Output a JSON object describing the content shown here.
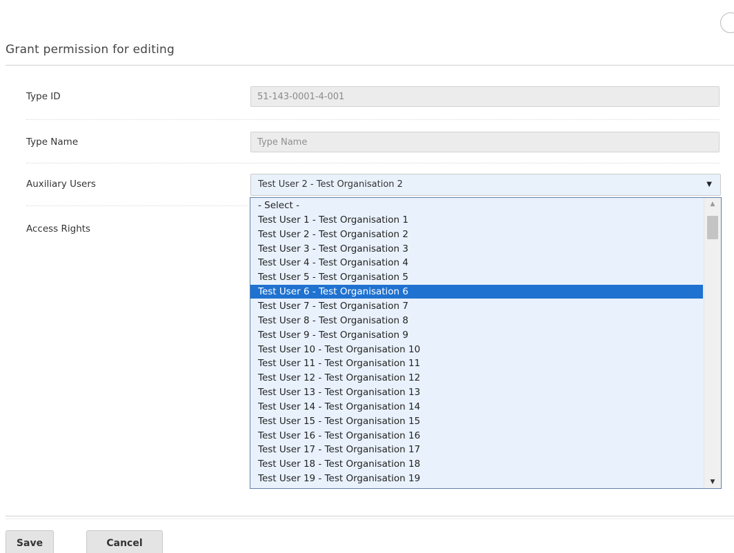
{
  "dialog": {
    "title": "Grant permission for editing"
  },
  "form": {
    "type_id_label": "Type ID",
    "type_id_value": "51-143-0001-4-001",
    "type_name_label": "Type Name",
    "type_name_placeholder": "Type Name",
    "auxiliary_users_label": "Auxiliary Users",
    "auxiliary_users_selected": "Test User 2 - Test Organisation 2",
    "access_rights_label": "Access Rights"
  },
  "dropdown": {
    "arrow_icon": "▼",
    "highlighted_index": 6,
    "options": [
      "- Select -",
      "Test User 1 - Test Organisation 1",
      "Test User 2 - Test Organisation 2",
      "Test User 3 - Test Organisation 3",
      "Test User 4 - Test Organisation 4",
      "Test User 5 - Test Organisation 5",
      "Test User 6 - Test Organisation 6",
      "Test User 7 - Test Organisation 7",
      "Test User 8 - Test Organisation 8",
      "Test User 9 - Test Organisation 9",
      "Test User 10 - Test Organisation 10",
      "Test User 11 - Test Organisation 11",
      "Test User 12 - Test Organisation 12",
      "Test User 13 - Test Organisation 13",
      "Test User 14 - Test Organisation 14",
      "Test User 15 - Test Organisation 15",
      "Test User 16 - Test Organisation 16",
      "Test User 17 - Test Organisation 17",
      "Test User 18 - Test Organisation 18",
      "Test User 19 - Test Organisation 19"
    ],
    "scroll_up_icon": "▲",
    "scroll_down_icon": "▼"
  },
  "footer": {
    "save_label": "Save",
    "cancel_label": "Cancel"
  },
  "colors": {
    "highlight": "#1f72d0",
    "list_background": "#e9f2fc",
    "input_disabled": "#ececec"
  }
}
